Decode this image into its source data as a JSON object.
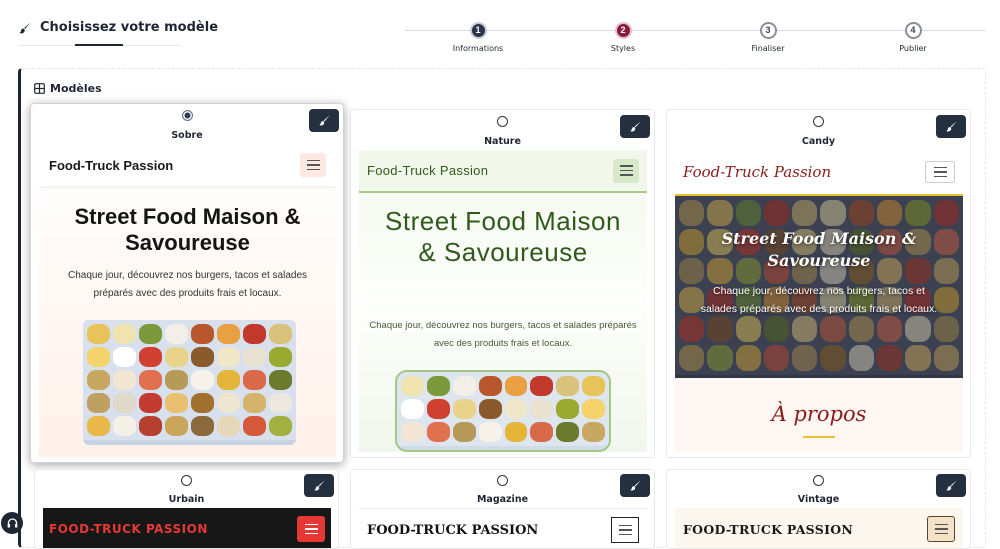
{
  "header": {
    "title": "Choisissez votre modèle"
  },
  "stepper": {
    "steps": [
      {
        "number": "1",
        "label": "Informations",
        "state": "done",
        "color": "#2b3448"
      },
      {
        "number": "2",
        "label": "Styles",
        "state": "active",
        "color": "#8a1c3b"
      },
      {
        "number": "3",
        "label": "Finaliser",
        "state": "pending",
        "color": "#8a8f99"
      },
      {
        "number": "4",
        "label": "Publier",
        "state": "pending",
        "color": "#8a8f99"
      }
    ]
  },
  "models": {
    "heading": "Modèles",
    "cards": [
      {
        "name": "Sobre",
        "selected": true,
        "brand": "Food-Truck Passion",
        "hero_title": "Street Food Maison & Savoureuse",
        "hero_text": "Chaque jour, découvrez nos burgers, tacos et salades préparés avec des produits frais et locaux."
      },
      {
        "name": "Nature",
        "selected": false,
        "brand": "Food-Truck Passion",
        "hero_title": "Street Food Maison & Savoureuse",
        "hero_text": "Chaque jour, découvrez nos burgers, tacos et salades préparés avec des produits frais et locaux."
      },
      {
        "name": "Candy",
        "selected": false,
        "brand": "Food-Truck Passion",
        "hero_title": "Street Food Maison & Savoureuse",
        "hero_text": "Chaque jour, découvrez nos burgers, tacos et salades préparés avec des produits frais et locaux.",
        "section_title": "À propos"
      },
      {
        "name": "Urbain",
        "selected": false,
        "brand": "FOOD-TRUCK PASSION"
      },
      {
        "name": "Magazine",
        "selected": false,
        "brand": "FOOD-TRUCK PASSION"
      },
      {
        "name": "Vintage",
        "selected": false,
        "brand": "FOOD-TRUCK PASSION"
      }
    ]
  },
  "icons": {
    "brush": "paintbrush-icon",
    "grid": "grid-icon",
    "help": "headset-icon"
  },
  "colors": {
    "dark": "#24303f",
    "active_step": "#8a1c3b",
    "nature_green": "#2f5a1c",
    "candy_red": "#8a1c1c",
    "urbain_red": "#e53935"
  }
}
